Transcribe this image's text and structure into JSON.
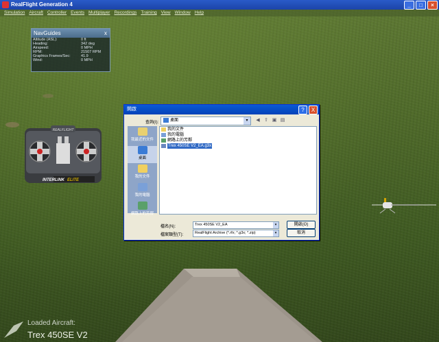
{
  "app": {
    "title": "RealFlight Generation 4"
  },
  "menu": [
    "Simulation",
    "Aircraft",
    "Controller",
    "Events",
    "Multiplayer",
    "Recordings",
    "Training",
    "View",
    "Window",
    "Help"
  ],
  "navguides": {
    "title": "NavGuides",
    "close": "x",
    "rows": [
      {
        "k": "Altitude (ASL):",
        "v": "0 ft"
      },
      {
        "k": "Heading:",
        "v": "342 deg"
      },
      {
        "k": "Airspeed:",
        "v": "0 MPH"
      },
      {
        "k": "RPM:",
        "v": "21507 RPM"
      },
      {
        "k": "Graphics Frames/Sec:",
        "v": "41.9"
      },
      {
        "k": "Wind:",
        "v": "0 MPH"
      }
    ]
  },
  "transmitter": {
    "brand": "REALFLIGHT",
    "label_a": "INTERLINK",
    "label_b": "ELITE"
  },
  "dialog": {
    "title": "開啟",
    "help_btn": "?",
    "close_btn": "X",
    "lookin_label": "查詢(I):",
    "lookin_value": "桌面",
    "places": [
      {
        "label": "我最近的文件",
        "icon": "recent-documents-icon"
      },
      {
        "label": "桌面",
        "icon": "desktop-icon"
      },
      {
        "label": "我的文件",
        "icon": "my-documents-icon"
      },
      {
        "label": "我的電腦",
        "icon": "my-computer-icon"
      },
      {
        "label": "網路上的芳鄰",
        "icon": "network-places-icon"
      }
    ],
    "files": [
      {
        "label": "我的文件",
        "icon": "folder-icon"
      },
      {
        "label": "我的電腦",
        "icon": "computer-icon"
      },
      {
        "label": "網路上的芳鄰",
        "icon": "network-icon"
      },
      {
        "label": "Trex 450SE V2_EA.g3x",
        "icon": "file-icon"
      }
    ],
    "filename_label": "檔名(N):",
    "filename_value": "Trex 450SE V2_EA",
    "filetype_label": "檔案類型(T):",
    "filetype_value": "RealFlight Archive (*.rfx; *.g3x; *.zip)",
    "open_btn": "開啟(O)",
    "cancel_btn": "取消"
  },
  "loaded": {
    "label": "Loaded Aircraft:",
    "value": "Trex 450SE V2"
  }
}
